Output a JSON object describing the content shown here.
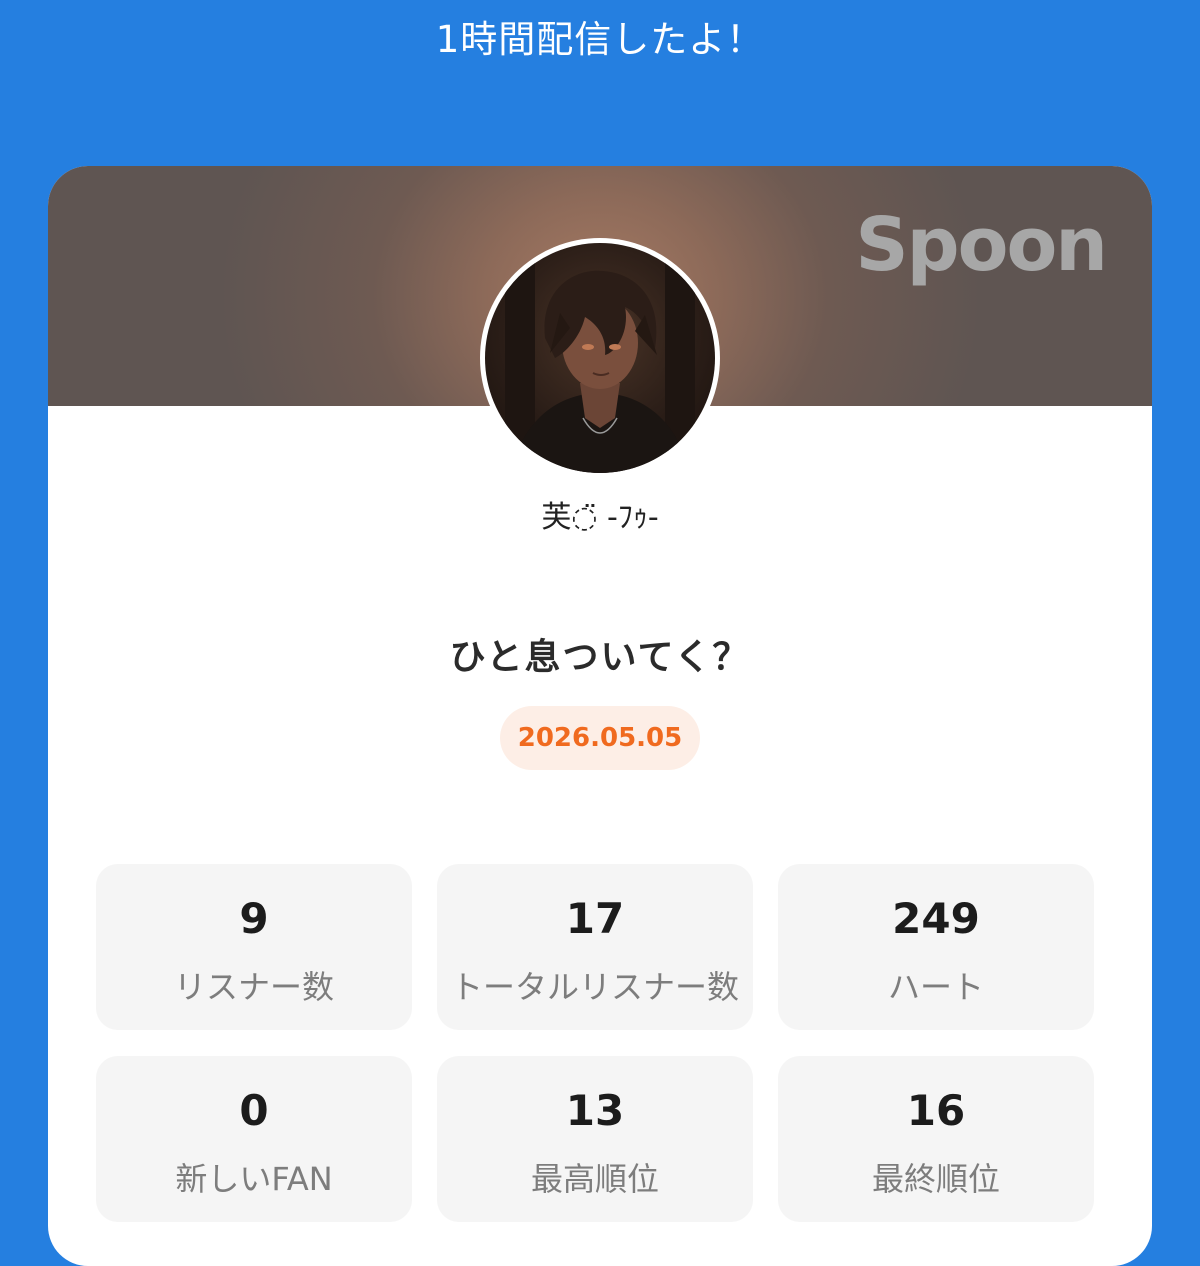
{
  "banner": {
    "text": "1時間配信したよ！"
  },
  "card": {
    "brand": "Spoon",
    "username": "芙◌̈ -ﾌｩ-",
    "live_title": "ひと息ついてく？",
    "date": "2026.05.05"
  },
  "stats": [
    {
      "value": "9",
      "label": "リスナー数"
    },
    {
      "value": "17",
      "label": "トータルリスナー数"
    },
    {
      "value": "249",
      "label": "ハート"
    },
    {
      "value": "0",
      "label": "新しいFAN"
    },
    {
      "value": "13",
      "label": "最高順位"
    },
    {
      "value": "16",
      "label": "最終順位"
    }
  ],
  "colors": {
    "background": "#257fe0",
    "date_accent": "#f06a1f",
    "date_badge_bg": "#fdeee6"
  }
}
